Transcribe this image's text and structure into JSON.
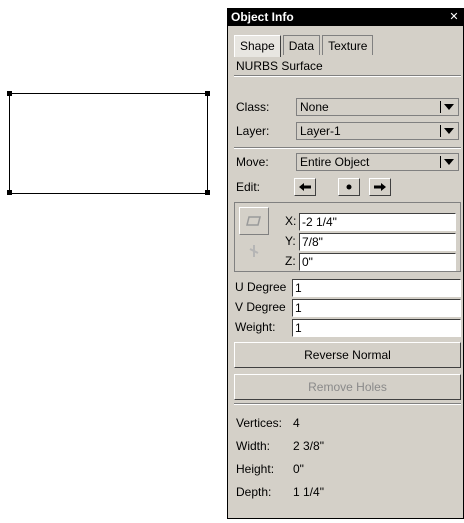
{
  "palette": {
    "title": "Object Info",
    "close": "✕",
    "tabs": [
      "Shape",
      "Data",
      "Texture"
    ],
    "object_type": "NURBS Surface"
  },
  "class": {
    "label": "Class:",
    "value": "None"
  },
  "layer": {
    "label": "Layer:",
    "value": "Layer-1"
  },
  "move": {
    "label": "Move:",
    "value": "Entire Object"
  },
  "edit": {
    "label": "Edit:",
    "buttons": [
      "left-arrow",
      "center",
      "right-arrow"
    ]
  },
  "position": {
    "x_label": "X:",
    "x_value": "-2 1/4\"",
    "y_label": "Y:",
    "y_value": "7/8\"",
    "z_label": "Z:",
    "z_value": "0\""
  },
  "params": {
    "u_label": "U Degree",
    "u_value": "1",
    "v_label": "V Degree",
    "v_value": "1",
    "w_label": "Weight:",
    "w_value": "1"
  },
  "actions": {
    "reverse_normal": "Reverse Normal",
    "remove_holes": "Remove Holes"
  },
  "info": {
    "vertices_label": "Vertices:",
    "vertices_value": "4",
    "width_label": "Width:",
    "width_value": "2 3/8\"",
    "height_label": "Height:",
    "height_value": "0\"",
    "depth_label": "Depth:",
    "depth_value": "1 1/4\""
  }
}
